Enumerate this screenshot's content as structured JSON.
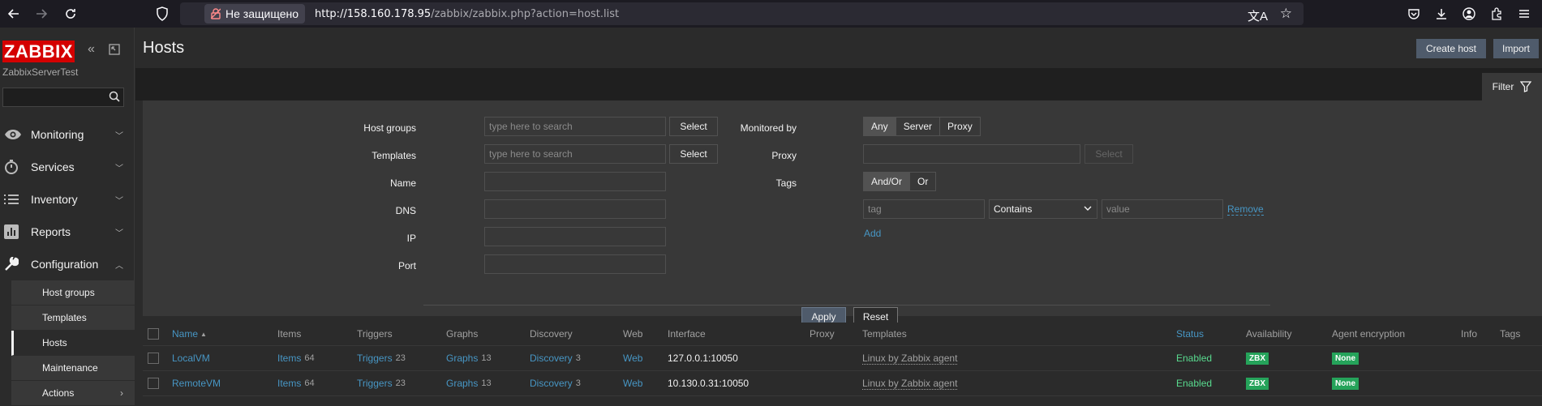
{
  "browser": {
    "security_label": "Не защищено",
    "url_host": "http://158.160.178.95",
    "url_path": "/zabbix/zabbix.php?action=host.list"
  },
  "sidebar": {
    "logo": "ZABBIX",
    "server_name": "ZabbixServerTest",
    "menu": [
      {
        "label": "Monitoring",
        "icon": "eye-icon"
      },
      {
        "label": "Services",
        "icon": "stopwatch-icon"
      },
      {
        "label": "Inventory",
        "icon": "list-icon"
      },
      {
        "label": "Reports",
        "icon": "bar-chart-icon"
      },
      {
        "label": "Configuration",
        "icon": "wrench-icon"
      }
    ],
    "submenu": [
      {
        "label": "Host groups"
      },
      {
        "label": "Templates"
      },
      {
        "label": "Hosts"
      },
      {
        "label": "Maintenance"
      },
      {
        "label": "Actions"
      }
    ]
  },
  "header": {
    "title": "Hosts",
    "create_host": "Create host",
    "import": "Import"
  },
  "filter": {
    "tab_label": "Filter",
    "host_groups_label": "Host groups",
    "host_groups_placeholder": "type here to search",
    "templates_label": "Templates",
    "templates_placeholder": "type here to search",
    "select_label": "Select",
    "name_label": "Name",
    "dns_label": "DNS",
    "ip_label": "IP",
    "port_label": "Port",
    "monitored_by_label": "Monitored by",
    "monitored_by_options": [
      "Any",
      "Server",
      "Proxy"
    ],
    "proxy_label": "Proxy",
    "tags_label": "Tags",
    "tags_mode_options": [
      "And/Or",
      "Or"
    ],
    "tag_placeholder": "tag",
    "tag_operator": "Contains",
    "value_placeholder": "value",
    "remove_label": "Remove",
    "add_label": "Add",
    "apply_label": "Apply",
    "reset_label": "Reset"
  },
  "table": {
    "columns": [
      "Name",
      "Items",
      "Triggers",
      "Graphs",
      "Discovery",
      "Web",
      "Interface",
      "Proxy",
      "Templates",
      "Status",
      "Availability",
      "Agent encryption",
      "Info",
      "Tags"
    ],
    "sort_indicator": "▲",
    "rows": [
      {
        "name": "LocalVM",
        "items": "Items",
        "items_count": "64",
        "triggers": "Triggers",
        "triggers_count": "23",
        "graphs": "Graphs",
        "graphs_count": "13",
        "discovery": "Discovery",
        "discovery_count": "3",
        "web": "Web",
        "interface": "127.0.0.1:10050",
        "templates": "Linux by Zabbix agent",
        "status": "Enabled",
        "availability": "ZBX",
        "encryption": "None"
      },
      {
        "name": "RemoteVM",
        "items": "Items",
        "items_count": "64",
        "triggers": "Triggers",
        "triggers_count": "23",
        "graphs": "Graphs",
        "graphs_count": "13",
        "discovery": "Discovery",
        "discovery_count": "3",
        "web": "Web",
        "interface": "10.130.0.31:10050",
        "templates": "Linux by Zabbix agent",
        "status": "Enabled",
        "availability": "ZBX",
        "encryption": "None"
      }
    ]
  },
  "colors": {
    "accent_link": "#4796c4",
    "status_enabled": "#59db8f",
    "badge_green": "#25a35a",
    "logo_red": "#d40000"
  }
}
